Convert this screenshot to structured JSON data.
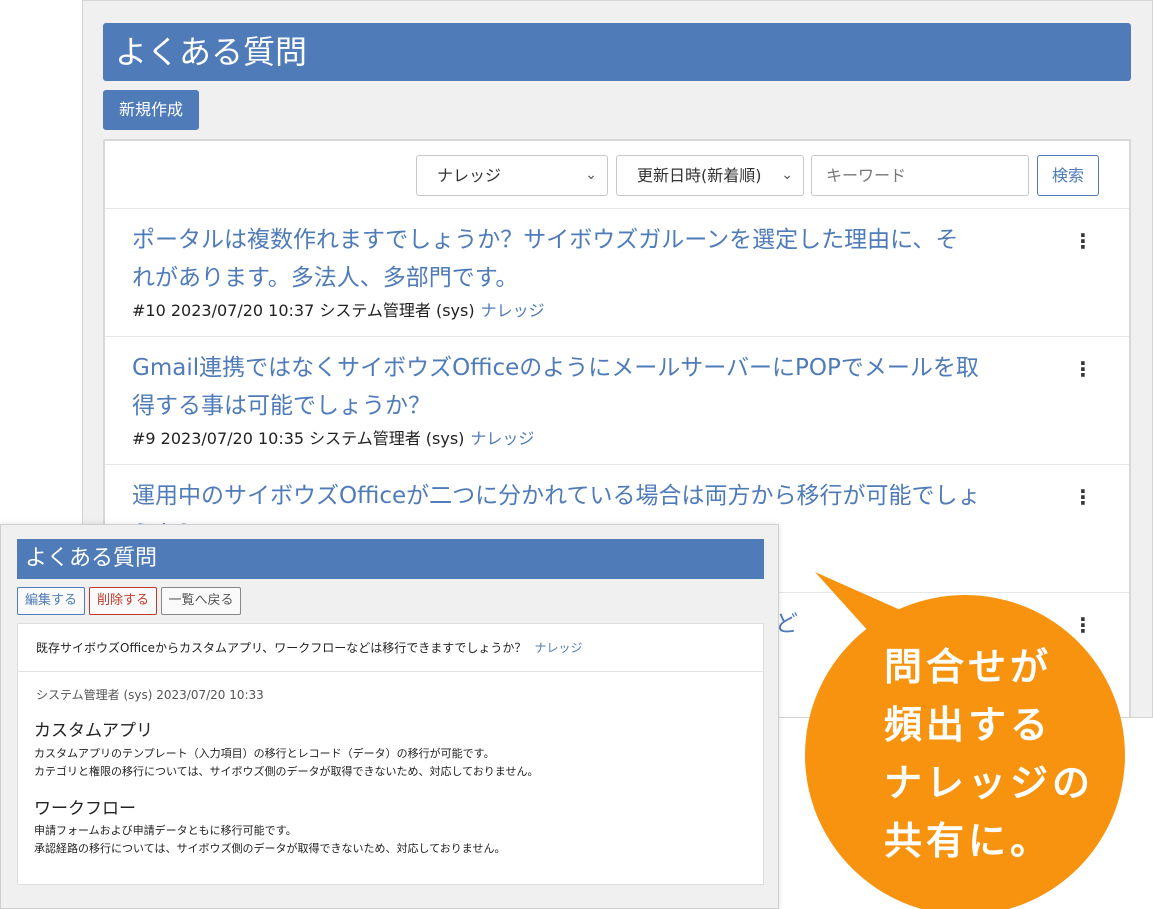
{
  "list_view": {
    "title": "よくある質問",
    "new_button": "新規作成",
    "filters": {
      "category_selected": "ナレッジ",
      "sort_selected": "更新日時(新着順)",
      "keyword_placeholder": "キーワード",
      "search_button": "検索"
    },
    "items": [
      {
        "title_line1": "ポータルは複数作れますでしょうか？サイボウズガルーンを選定した理由に、そ",
        "title_line2": "れがあります。多法人、多部門です。",
        "meta": "#10 2023/07/20 10:37 システム管理者 (sys)",
        "tag": "ナレッジ"
      },
      {
        "title_line1": "Gmail連携ではなくサイボウズOfficeのようにメールサーバーにPOPでメールを取",
        "title_line2": "得する事は可能でしょうか？",
        "meta": "#9 2023/07/20 10:35 システム管理者 (sys)",
        "tag": "ナレッジ"
      },
      {
        "title_line1": "運用中のサイボウズOfficeが二つに分かれている場合は両方から移行が可能でしょ",
        "title_line2": "うか？"
      },
      {
        "title_fragment": "など"
      }
    ],
    "kebab_glyph": "⋮"
  },
  "detail_view": {
    "title": "よくある質問",
    "buttons": {
      "edit": "編集する",
      "delete": "削除する",
      "back": "一覧へ戻る"
    },
    "question": "既存サイボウズOfficeからカスタムアプリ、ワークフローなどは移行できますでしょうか？",
    "tag": "ナレッジ",
    "meta": "システム管理者 (sys)  2023/07/20 10:33",
    "sections": [
      {
        "heading": "カスタムアプリ",
        "line1": "カスタムアプリのテンプレート（入力項目）の移行とレコード（データ）の移行が可能です。",
        "line2": "カテゴリと権限の移行については、サイボウズ側のデータが取得できないため、対応しておりません。"
      },
      {
        "heading": "ワークフロー",
        "line1": "申請フォームおよび申請データともに移行可能です。",
        "line2": "承認経路の移行については、サイボウズ側のデータが取得できないため、対応しておりません。"
      }
    ]
  },
  "callout": {
    "lines": [
      "問合せが",
      "頻出する",
      "ナレッジの",
      "共有に。"
    ]
  },
  "colors": {
    "brand_blue": "#4f7bb9",
    "callout_orange": "#f7930e",
    "delete_red": "#c0392b"
  }
}
